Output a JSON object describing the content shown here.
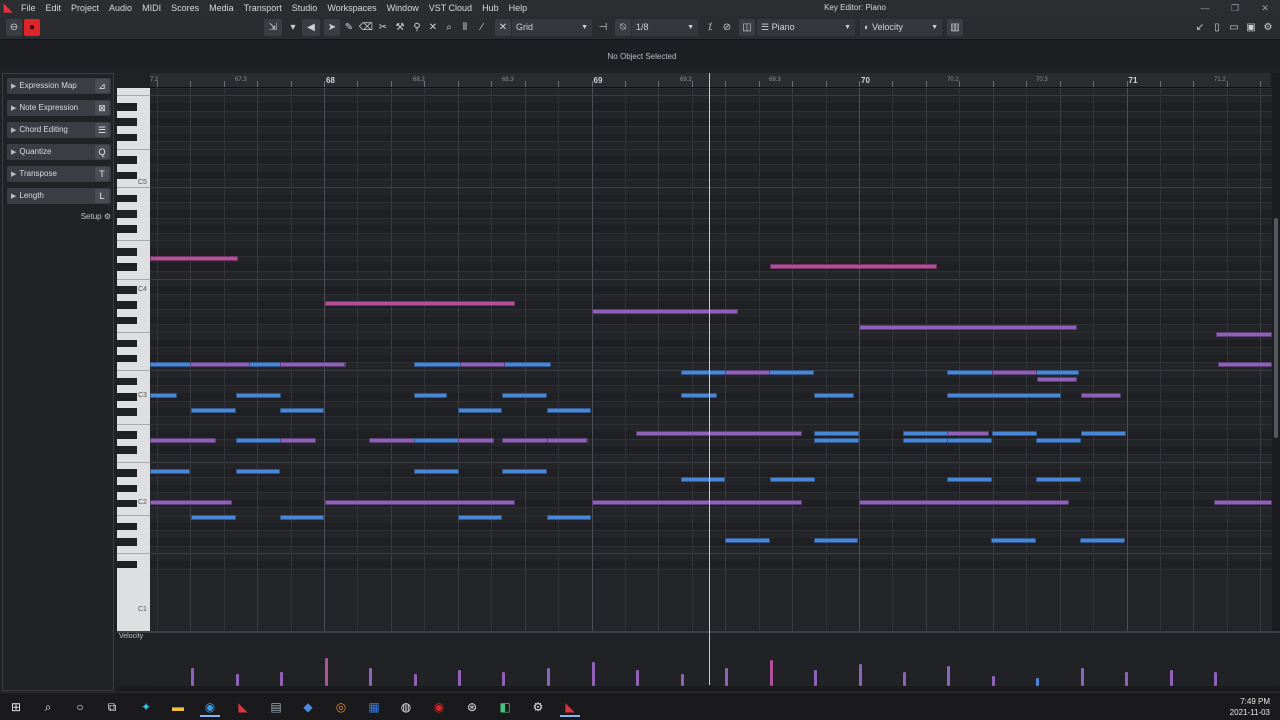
{
  "app": {
    "title": "Key Editor: Piano"
  },
  "menu": [
    "File",
    "Edit",
    "Project",
    "Audio",
    "MIDI",
    "Scores",
    "Media",
    "Transport",
    "Studio",
    "Workspaces",
    "Window",
    "VST Cloud",
    "Hub",
    "Help"
  ],
  "toolbar": {
    "snap_type": "Grid",
    "quantize": "1/8",
    "instrument": "Piano",
    "lane_param": "Velocity"
  },
  "info_line": {
    "text": "No Object Selected"
  },
  "inspector": {
    "sections": [
      {
        "label": "Expression Map",
        "icon": "expression-map-icon"
      },
      {
        "label": "Note Expression",
        "icon": "note-expression-icon"
      },
      {
        "label": "Chord Editing",
        "icon": "chord-editing-icon"
      },
      {
        "label": "Quantize",
        "icon": "quantize-icon"
      },
      {
        "label": "Transpose",
        "icon": "transpose-icon"
      },
      {
        "label": "Length",
        "icon": "length-icon"
      }
    ],
    "setup_label": "Setup"
  },
  "ruler": {
    "bars": [
      {
        "label": "68"
      },
      {
        "label": "69"
      },
      {
        "label": "70"
      },
      {
        "label": "71"
      }
    ],
    "beats": [
      "7.2",
      "67.3",
      "68.2",
      "68.3",
      "69.2",
      "69.3",
      "70.2",
      "70.3",
      "71.2"
    ]
  },
  "keyboard": {
    "octave_labels": [
      "C5",
      "C4",
      "C3",
      "C2",
      "C1"
    ]
  },
  "velocity_lane": {
    "label": "Velocity"
  },
  "colors": {
    "note_blue": "#4a87d8",
    "note_purple": "#8f62b8",
    "note_pink": "#b3509a",
    "record": "#e0222b"
  },
  "taskbar": {
    "time": "7:49 PM",
    "date": "2021-11-03"
  }
}
